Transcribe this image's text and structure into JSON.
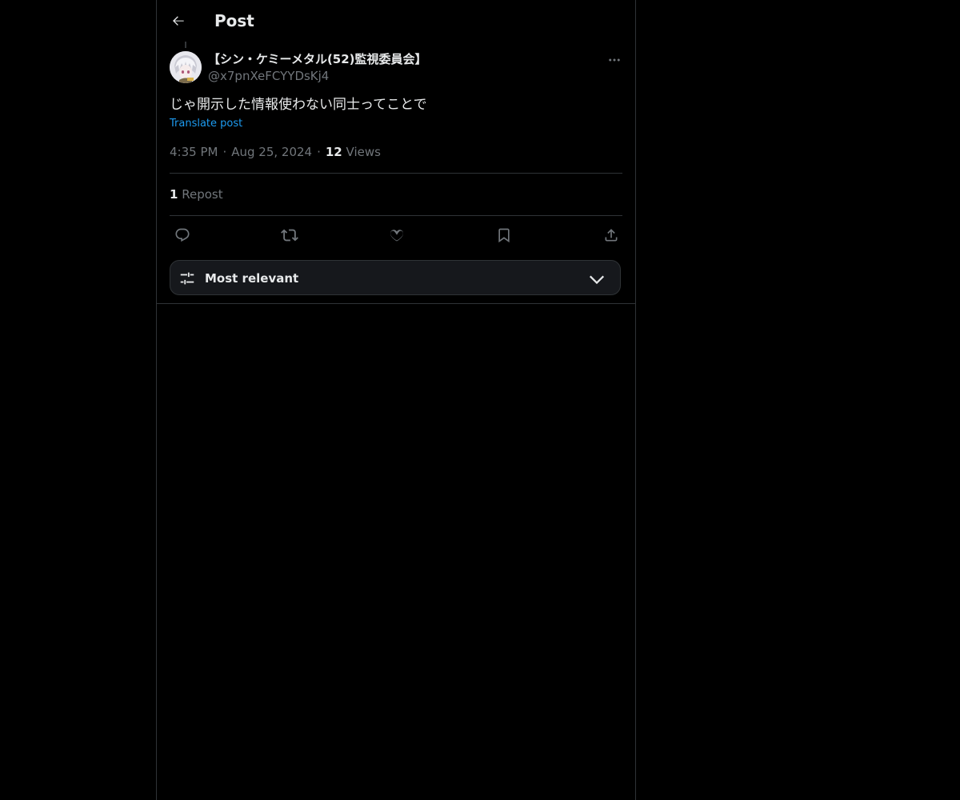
{
  "header": {
    "title": "Post",
    "back_icon": "arrow-left-icon"
  },
  "post": {
    "author": {
      "display_name": "【シン・ケミーメタル(52)監視委員会】",
      "handle": "@x7pnXeFCYYDsKj4"
    },
    "text": "じゃ開示した情報使わない同士ってことで",
    "translate_label": "Translate post",
    "time": "4:35 PM",
    "date": "Aug 25, 2024",
    "separator": "·",
    "views_count": "12",
    "views_label": "Views",
    "reposts_count": "1",
    "reposts_label": "Repost"
  },
  "actions": [
    {
      "name": "reply",
      "icon": "reply-icon"
    },
    {
      "name": "repost",
      "icon": "repost-icon"
    },
    {
      "name": "like",
      "icon": "heart-icon"
    },
    {
      "name": "bookmark",
      "icon": "bookmark-icon"
    },
    {
      "name": "share",
      "icon": "share-icon"
    }
  ],
  "sort": {
    "label": "Most relevant",
    "icon": "sliders-icon"
  },
  "colors": {
    "background": "#000000",
    "text": "#e7e9ea",
    "secondary_text": "#71767b",
    "accent": "#1d9bf0",
    "border": "#2f3336"
  }
}
